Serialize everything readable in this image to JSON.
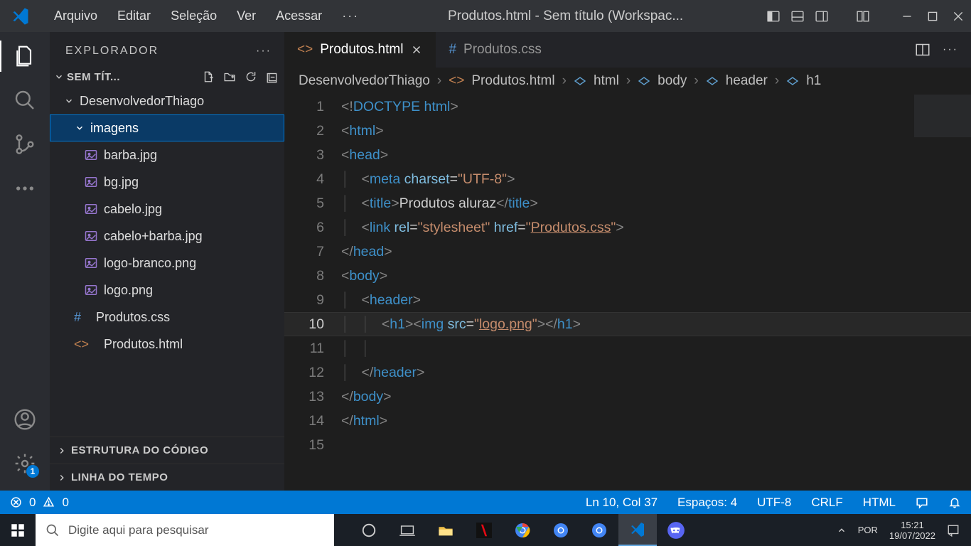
{
  "menu": {
    "file": "Arquivo",
    "edit": "Editar",
    "select": "Seleção",
    "view": "Ver",
    "go": "Acessar",
    "more": "···"
  },
  "window_title": "Produtos.html - Sem título (Workspac...",
  "explorer": {
    "header": "EXPLORADOR",
    "workspace": "SEM TÍT...",
    "items": {
      "root": "DesenvolvedorThiago",
      "imagens": "imagens",
      "files": [
        "barba.jpg",
        "bg.jpg",
        "cabelo.jpg",
        "cabelo+barba.jpg",
        "logo-branco.png",
        "logo.png"
      ],
      "produtos_css": "Produtos.css",
      "produtos_html": "Produtos.html"
    },
    "footer": {
      "outline": "ESTRUTURA DO CÓDIGO",
      "timeline": "LINHA DO TEMPO"
    }
  },
  "tabs": {
    "t0": "Produtos.html",
    "t1": "Produtos.css"
  },
  "breadcrumb": {
    "p0": "DesenvolvedorThiago",
    "p1": "Produtos.html",
    "p2": "html",
    "p3": "body",
    "p4": "header",
    "p5": "h1"
  },
  "code_text": {
    "doctype": "DOCTYPE",
    "html": "html",
    "head": "head",
    "meta": "meta",
    "charset": "charset",
    "utf8": "\"UTF-8\"",
    "title": "title",
    "title_txt": "Produtos aluraz",
    "link": "link",
    "rel": "rel",
    "stylesheet": "\"stylesheet\"",
    "href": "href",
    "produtos_css": "Produtos.css",
    "body": "body",
    "header": "header",
    "h1": "h1",
    "img": "img",
    "src": "src",
    "logo": "logo.png"
  },
  "status": {
    "errors": "0",
    "warnings": "0",
    "ln_col": "Ln 10, Col 37",
    "spaces": "Espaços: 4",
    "enc": "UTF-8",
    "eol": "CRLF",
    "lang": "HTML"
  },
  "taskbar": {
    "search_placeholder": "Digite aqui para pesquisar",
    "lang": "POR",
    "time": "15:21",
    "date": "19/07/2022"
  },
  "gear_badge": "1"
}
